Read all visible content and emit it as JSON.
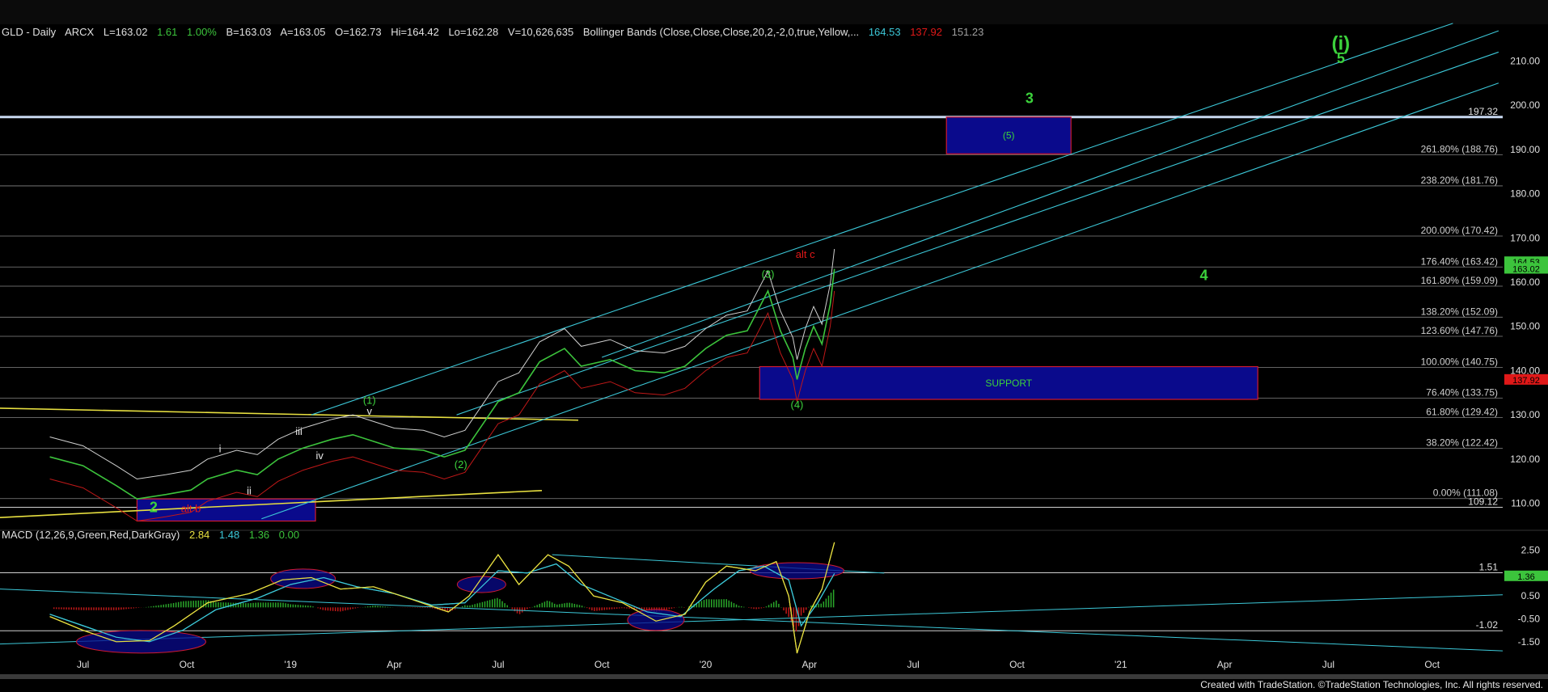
{
  "header": {
    "symbol": "GLD - Daily",
    "exchange": "ARCX",
    "last": "L=163.02",
    "change": "1.61",
    "change_pct": "1.00%",
    "bid": "B=163.03",
    "ask": "A=163.05",
    "open": "O=162.73",
    "high": "Hi=164.42",
    "low": "Lo=162.28",
    "volume": "V=10,626,635",
    "indicator": "Bollinger Bands (Close,Close,Close,20,2,-2,0,true,Yellow,...",
    "bb_upper": "164.53",
    "bb_lower": "137.92",
    "bb_mid": "151.23"
  },
  "macd_header": {
    "label": "MACD (12,26,9,Green,Red,DarkGray)",
    "macd": "2.84",
    "signal": "1.48",
    "diff": "1.36",
    "zero": "0.00"
  },
  "footer": "Created with TradeStation. ©TradeStation Technologies, Inc. All rights reserved.",
  "colors": {
    "background": "#000000",
    "price": "#3cc43c",
    "bollinger": "#d0d0d0",
    "trendline": "#3cc8d8",
    "fib_line": "#b0b0b0",
    "zone_fill": "#0a0a8c",
    "zone_border": "#d01a30",
    "wave_green": "#3cd23c",
    "wave_red": "#e01818",
    "yellow": "#e8e040"
  },
  "chart_data": [
    {
      "type": "line",
      "title": "GLD - Daily",
      "ylim": [
        105,
        215
      ],
      "y_ticks": [
        "110.00",
        "120.00",
        "130.00",
        "140.00",
        "150.00",
        "160.00",
        "170.00",
        "180.00",
        "190.00",
        "200.00",
        "210.00"
      ],
      "x_ticks": [
        "Jul",
        "Oct",
        "'19",
        "Apr",
        "Jul",
        "Oct",
        "'20",
        "Apr",
        "Jul",
        "Oct",
        "'21",
        "Apr",
        "Jul",
        "Oct"
      ],
      "series": [
        {
          "name": "GLD",
          "points": [
            [
              2018.42,
              120.5
            ],
            [
              2018.5,
              118.5
            ],
            [
              2018.58,
              114.0
            ],
            [
              2018.63,
              111.0
            ],
            [
              2018.7,
              112.0
            ],
            [
              2018.76,
              113.0
            ],
            [
              2018.8,
              115.5
            ],
            [
              2018.87,
              117.5
            ],
            [
              2018.92,
              116.5
            ],
            [
              2018.97,
              120.0
            ],
            [
              2019.03,
              122.5
            ],
            [
              2019.1,
              124.5
            ],
            [
              2019.15,
              125.5
            ],
            [
              2019.2,
              124.0
            ],
            [
              2019.25,
              122.5
            ],
            [
              2019.32,
              122.0
            ],
            [
              2019.37,
              120.5
            ],
            [
              2019.42,
              122.0
            ],
            [
              2019.46,
              127.5
            ],
            [
              2019.5,
              133.0
            ],
            [
              2019.55,
              135.0
            ],
            [
              2019.6,
              142.0
            ],
            [
              2019.66,
              145.0
            ],
            [
              2019.7,
              141.0
            ],
            [
              2019.77,
              142.5
            ],
            [
              2019.83,
              140.0
            ],
            [
              2019.9,
              139.5
            ],
            [
              2019.95,
              141.0
            ],
            [
              2020.0,
              145.0
            ],
            [
              2020.05,
              148.0
            ],
            [
              2020.1,
              149.0
            ],
            [
              2020.15,
              158.0
            ],
            [
              2020.18,
              149.0
            ],
            [
              2020.21,
              143.0
            ],
            [
              2020.22,
              138.0
            ],
            [
              2020.24,
              145.0
            ],
            [
              2020.26,
              150.0
            ],
            [
              2020.28,
              146.0
            ],
            [
              2020.3,
              155.0
            ],
            [
              2020.31,
              163.0
            ]
          ]
        }
      ],
      "fibonacci_levels": [
        {
          "label": "0.00% (111.08)",
          "value": 111.08
        },
        {
          "label": "38.20% (122.42)",
          "value": 122.42
        },
        {
          "label": "61.80% (129.42)",
          "value": 129.42
        },
        {
          "label": "76.40% (133.75)",
          "value": 133.75
        },
        {
          "label": "100.00% (140.75)",
          "value": 140.75
        },
        {
          "label": "123.60% (147.76)",
          "value": 147.76
        },
        {
          "label": "138.20% (152.09)",
          "value": 152.09
        },
        {
          "label": "161.80% (159.09)",
          "value": 159.09
        },
        {
          "label": "176.40% (163.42)",
          "value": 163.42
        },
        {
          "label": "200.00% (170.42)",
          "value": 170.42
        },
        {
          "label": "238.20% (181.76)",
          "value": 181.76
        },
        {
          "label": "261.80% (188.76)",
          "value": 188.76
        }
      ],
      "horizontal_levels": [
        {
          "label": "197.32",
          "value": 197.32
        },
        {
          "label": "109.12",
          "value": 109.12
        }
      ],
      "price_tags": [
        {
          "label": "164.53",
          "value": 164.53,
          "color": "#3cc43c"
        },
        {
          "label": "163.02",
          "value": 163.02,
          "color": "#3cc43c"
        },
        {
          "label": "137.92",
          "value": 137.92,
          "color": "#e01818"
        }
      ],
      "zones": [
        {
          "label": "(5)",
          "x": [
            2020.58,
            2020.88
          ],
          "y": [
            189.0,
            197.3
          ]
        },
        {
          "label": "SUPPORT",
          "x": [
            2020.13,
            2021.33
          ],
          "y": [
            133.5,
            140.9
          ]
        },
        {
          "label": "",
          "x": [
            2018.63,
            2019.06
          ],
          "y": [
            106.0,
            111.0
          ]
        }
      ],
      "annotations": [
        {
          "text": "(i)",
          "x": 2021.53,
          "y": 212.5,
          "color": "green",
          "size": "large"
        },
        {
          "text": "5",
          "x": 2021.53,
          "y": 209.5,
          "color": "green",
          "size": "medium"
        },
        {
          "text": "3",
          "x": 2020.78,
          "y": 200.5,
          "color": "green",
          "size": "medium"
        },
        {
          "text": "alt c",
          "x": 2020.24,
          "y": 165.5,
          "color": "red",
          "size": "small"
        },
        {
          "text": "(3)",
          "x": 2020.15,
          "y": 161.0,
          "color": "green",
          "size": "small"
        },
        {
          "text": "4",
          "x": 2021.2,
          "y": 160.5,
          "color": "green",
          "size": "medium"
        },
        {
          "text": "(4)",
          "x": 2020.22,
          "y": 131.5,
          "color": "green",
          "size": "small"
        },
        {
          "text": "(1)",
          "x": 2019.19,
          "y": 132.5,
          "color": "green",
          "size": "small"
        },
        {
          "text": "v",
          "x": 2019.19,
          "y": 130.0,
          "color": "white",
          "size": "small"
        },
        {
          "text": "iii",
          "x": 2019.02,
          "y": 125.5,
          "color": "white",
          "size": "small"
        },
        {
          "text": "i",
          "x": 2018.83,
          "y": 121.5,
          "color": "white",
          "size": "small"
        },
        {
          "text": "iv",
          "x": 2019.07,
          "y": 120.0,
          "color": "white",
          "size": "small"
        },
        {
          "text": "ii",
          "x": 2018.9,
          "y": 112.0,
          "color": "white",
          "size": "small"
        },
        {
          "text": "(2)",
          "x": 2019.41,
          "y": 118.0,
          "color": "green",
          "size": "small"
        },
        {
          "text": "2",
          "x": 2018.67,
          "y": 108.0,
          "color": "green",
          "size": "medium"
        },
        {
          "text": "alt b",
          "x": 2018.76,
          "y": 108.0,
          "color": "red",
          "size": "small"
        }
      ],
      "legend": "none"
    },
    {
      "type": "line",
      "title": "MACD (12,26,9,Green,Red,DarkGray)",
      "ylim": [
        -2.0,
        2.8
      ],
      "y_ticks": [
        "2.50",
        "0.50",
        "-0.50",
        "-1.50"
      ],
      "levels": [
        {
          "label": "1.51",
          "value": 1.51
        },
        {
          "label": "-1.02",
          "value": -1.02
        }
      ],
      "price_tags": [
        {
          "label": "1.36",
          "value": 1.36,
          "color": "#3cc43c"
        }
      ],
      "series": [
        {
          "name": "MACD",
          "points": [
            [
              2018.42,
              -0.4
            ],
            [
              2018.5,
              -1.0
            ],
            [
              2018.58,
              -1.5
            ],
            [
              2018.66,
              -1.45
            ],
            [
              2018.72,
              -0.8
            ],
            [
              2018.8,
              0.2
            ],
            [
              2018.9,
              0.6
            ],
            [
              2018.98,
              1.2
            ],
            [
              2019.05,
              1.3
            ],
            [
              2019.12,
              0.8
            ],
            [
              2019.2,
              0.9
            ],
            [
              2019.3,
              0.3
            ],
            [
              2019.38,
              -0.2
            ],
            [
              2019.43,
              0.5
            ],
            [
              2019.5,
              2.3
            ],
            [
              2019.55,
              1.0
            ],
            [
              2019.62,
              2.3
            ],
            [
              2019.67,
              1.8
            ],
            [
              2019.73,
              0.5
            ],
            [
              2019.8,
              0.2
            ],
            [
              2019.88,
              -0.6
            ],
            [
              2019.95,
              -0.3
            ],
            [
              2020.0,
              1.1
            ],
            [
              2020.05,
              1.8
            ],
            [
              2020.12,
              1.6
            ],
            [
              2020.17,
              2.0
            ],
            [
              2020.2,
              0.5
            ],
            [
              2020.22,
              -2.0
            ],
            [
              2020.25,
              -0.2
            ],
            [
              2020.28,
              0.8
            ],
            [
              2020.31,
              2.84
            ]
          ]
        },
        {
          "name": "Signal",
          "points": [
            [
              2018.42,
              -0.3
            ],
            [
              2018.5,
              -0.8
            ],
            [
              2018.58,
              -1.3
            ],
            [
              2018.66,
              -1.5
            ],
            [
              2018.74,
              -1.0
            ],
            [
              2018.82,
              -0.1
            ],
            [
              2018.92,
              0.4
            ],
            [
              2019.0,
              1.0
            ],
            [
              2019.08,
              1.3
            ],
            [
              2019.16,
              0.9
            ],
            [
              2019.25,
              0.6
            ],
            [
              2019.34,
              0.1
            ],
            [
              2019.42,
              0.2
            ],
            [
              2019.5,
              1.6
            ],
            [
              2019.57,
              1.5
            ],
            [
              2019.64,
              1.9
            ],
            [
              2019.7,
              1.0
            ],
            [
              2019.78,
              0.4
            ],
            [
              2019.86,
              -0.2
            ],
            [
              2019.94,
              -0.4
            ],
            [
              2020.02,
              0.8
            ],
            [
              2020.08,
              1.6
            ],
            [
              2020.14,
              1.8
            ],
            [
              2020.2,
              1.2
            ],
            [
              2020.23,
              -0.8
            ],
            [
              2020.27,
              0.2
            ],
            [
              2020.31,
              1.48
            ]
          ]
        }
      ],
      "legend": "none"
    }
  ]
}
